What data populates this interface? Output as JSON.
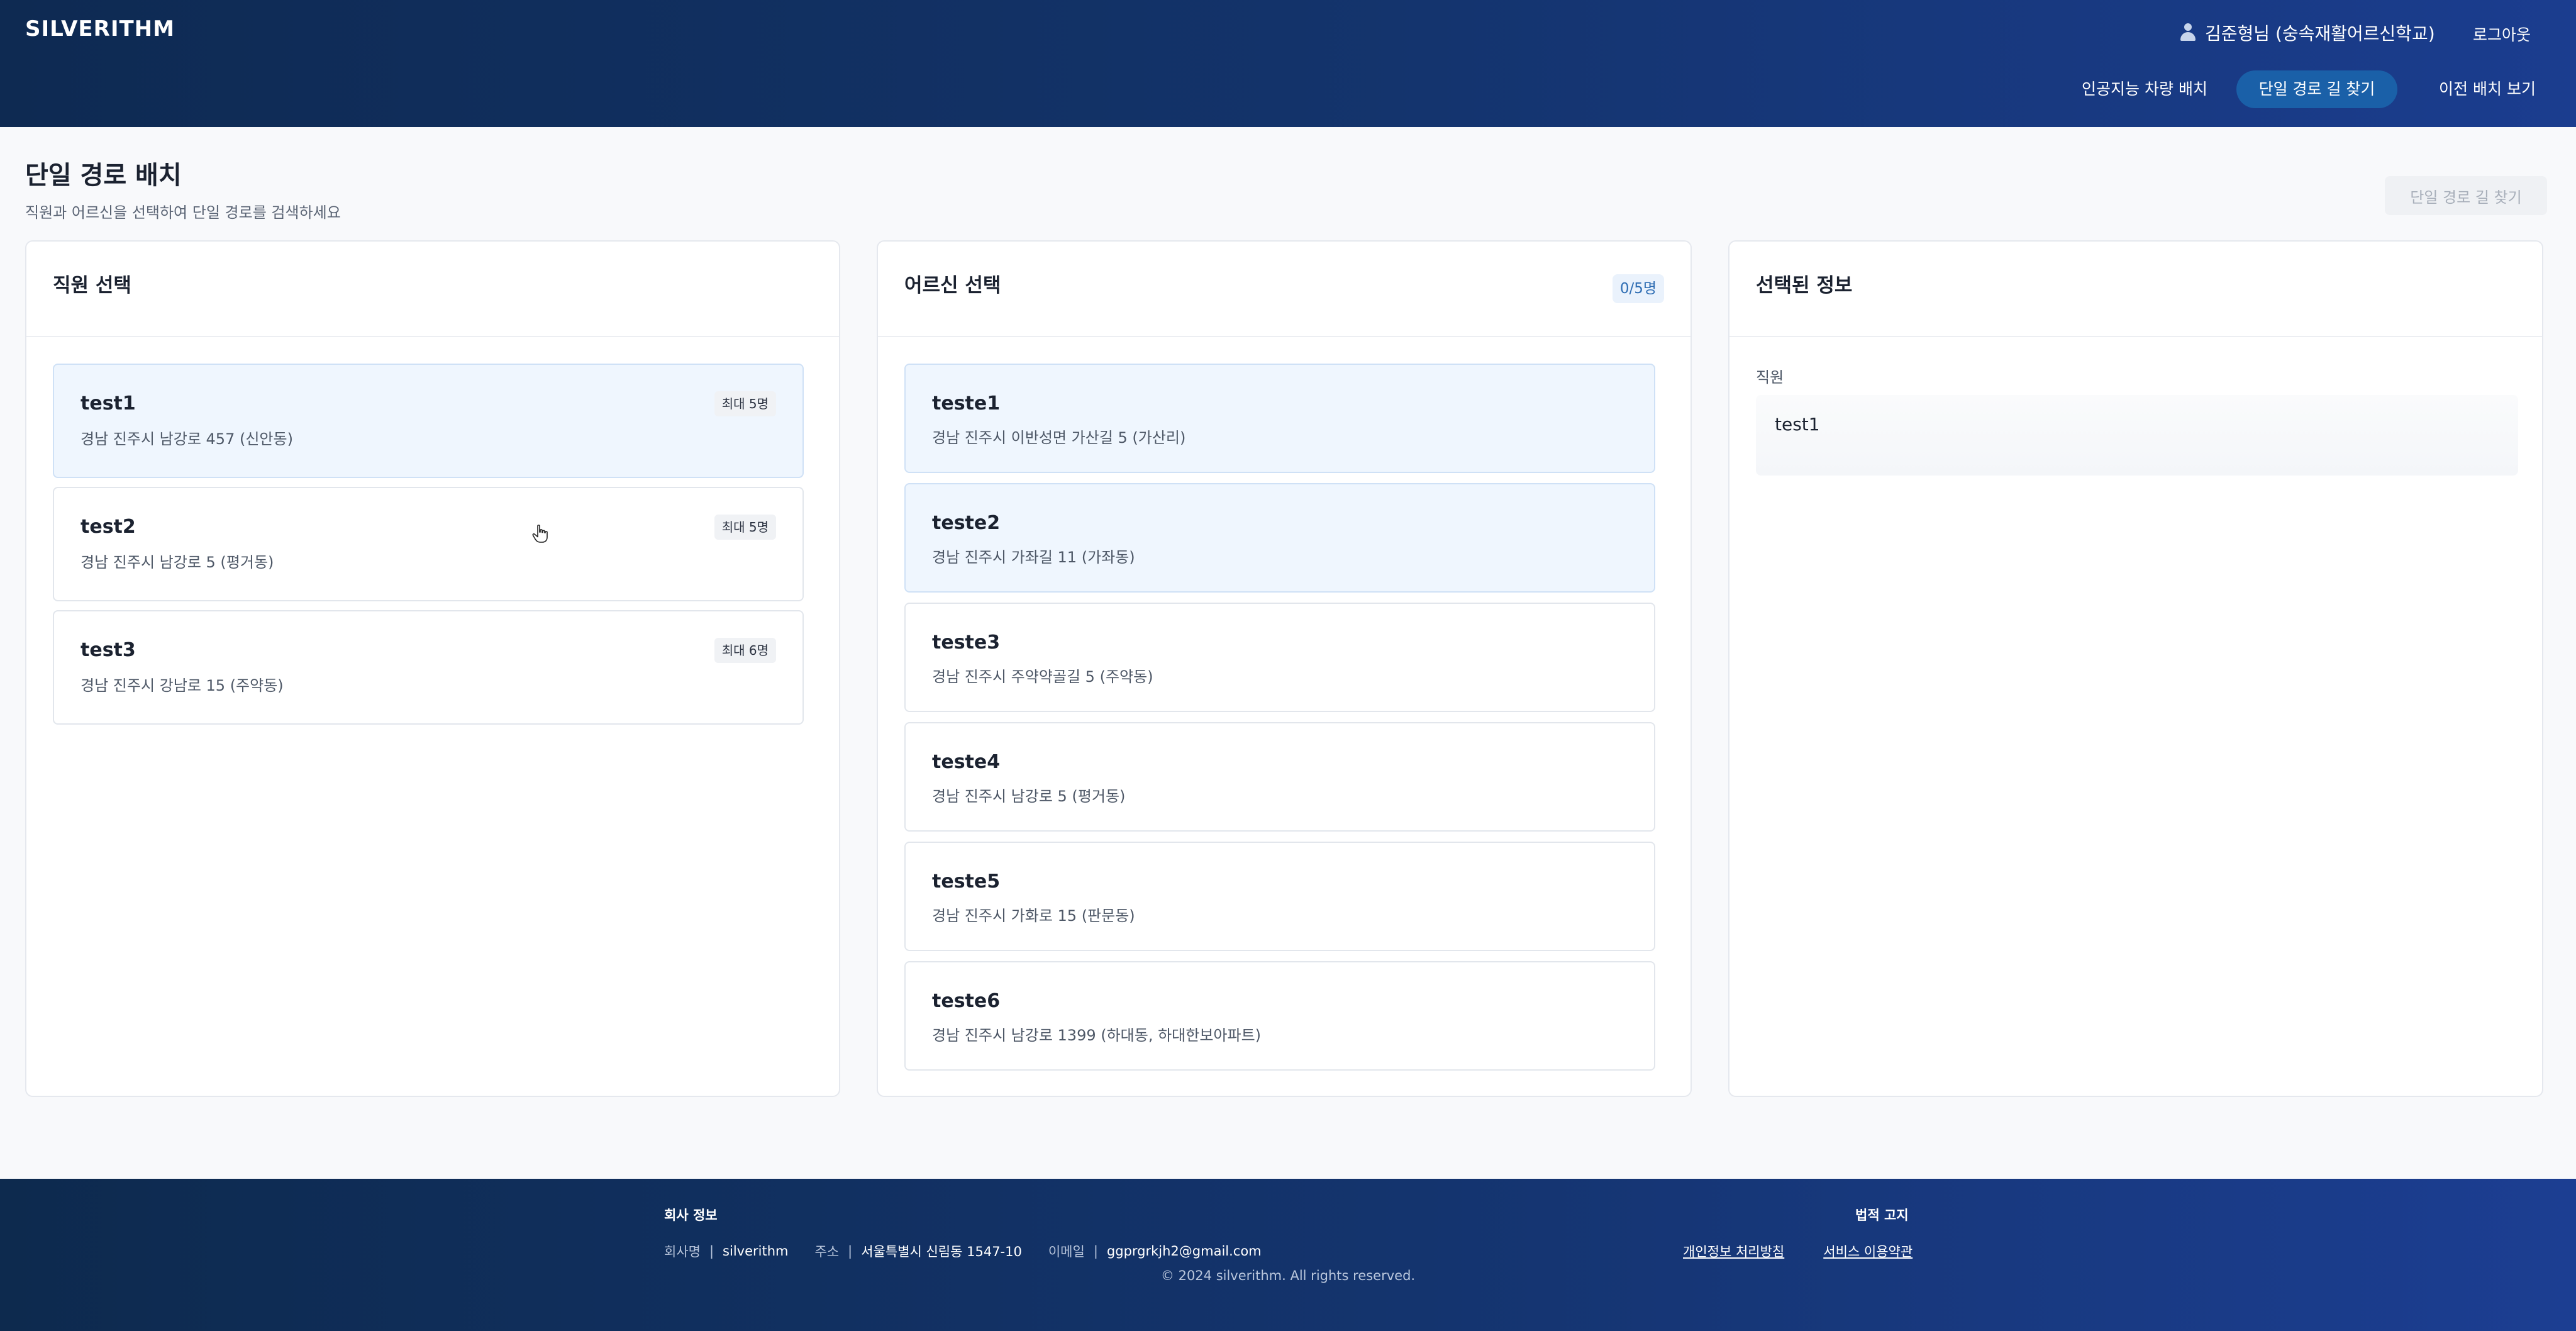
{
  "header": {
    "logo": "SILVERITHM",
    "user": "김준형님 (숭속재활어르신학교)",
    "logout": "로그아웃",
    "nav": [
      {
        "label": "인공지능 차량 배치"
      },
      {
        "label": "단일 경로 길 찾기"
      },
      {
        "label": "이전 배치 보기"
      }
    ]
  },
  "page": {
    "title": "단일 경로 배치",
    "subtitle": "직원과 어르신을 선택하여 단일 경로를 검색하세요",
    "action": "단일 경로 길 찾기"
  },
  "staff_panel": {
    "title": "직원 선택",
    "items": [
      {
        "name": "test1",
        "address": "경남 진주시 남강로 457 (신안동)",
        "capacity": "최대 5명"
      },
      {
        "name": "test2",
        "address": "경남 진주시 남강로 5 (평거동)",
        "capacity": "최대 5명"
      },
      {
        "name": "test3",
        "address": "경남 진주시 강남로 15 (주약동)",
        "capacity": "최대 6명"
      }
    ]
  },
  "senior_panel": {
    "title": "어르신 선택",
    "count": "0/5명",
    "items": [
      {
        "name": "teste1",
        "address": "경남 진주시 이반성면 가산길 5 (가산리)"
      },
      {
        "name": "teste2",
        "address": "경남 진주시 가좌길 11 (가좌동)"
      },
      {
        "name": "teste3",
        "address": "경남 진주시 주약약골길 5 (주약동)"
      },
      {
        "name": "teste4",
        "address": "경남 진주시 남강로 5 (평거동)"
      },
      {
        "name": "teste5",
        "address": "경남 진주시 가화로 15 (판문동)"
      },
      {
        "name": "teste6",
        "address": "경남 진주시 남강로 1399 (하대동, 하대한보아파트)"
      }
    ]
  },
  "info_panel": {
    "title": "선택된 정보",
    "label": "직원",
    "value": "test1"
  },
  "footer": {
    "company_heading": "회사 정보",
    "legal_heading": "법적 고지",
    "company_label": "회사명",
    "company_value": "silverithm",
    "address_label": "주소",
    "address_value": "서울특별시 신림동 1547-10",
    "email_label": "이메일",
    "email_value": "ggprgrkjh2@gmail.com",
    "privacy": "개인정보 처리방침",
    "terms": "서비스 이용약관",
    "copyright": "© 2024 silverithm. All rights reserved."
  }
}
